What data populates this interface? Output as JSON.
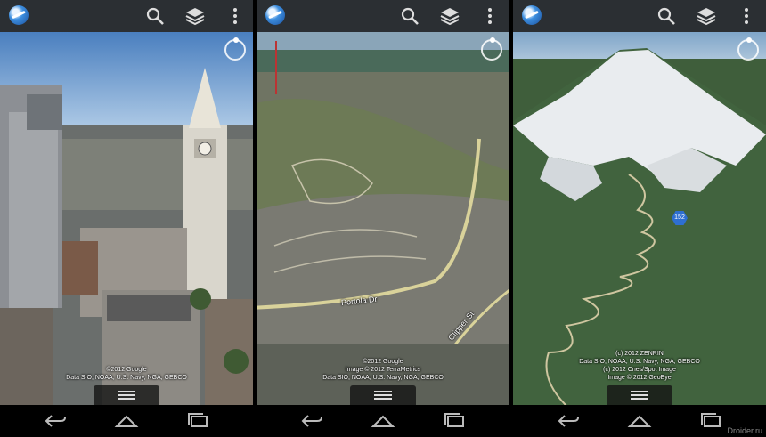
{
  "screens": [
    {
      "id": "boston",
      "attribution": [
        "",
        ""
      ],
      "attribution_lines": [
        "©2012 Google",
        "Data SIO, NOAA, U.S. Navy, NGA, GEBCO"
      ],
      "labels": []
    },
    {
      "id": "sf",
      "attribution_lines": [
        "©2012 Google",
        "Image © 2012 TerraMetrics",
        "Data SIO, NOAA, U.S. Navy, NGA, GEBCO"
      ],
      "labels": [
        "Portola Dr",
        "Clipper St"
      ]
    },
    {
      "id": "fuji",
      "attribution_lines": [
        "(c) 2012 ZENRIN",
        "Data SIO, NOAA, U.S. Navy, NGA, GEBCO",
        "(c) 2012 Cnes/Spot Image",
        "Image © 2012 GeoEye"
      ],
      "marker": "152"
    }
  ],
  "icons": {
    "logo": "google-earth-logo-icon",
    "search": "search-icon",
    "layers": "layers-icon",
    "menu": "overflow-menu-icon",
    "compass": "compass-icon",
    "back": "back-icon",
    "home": "home-icon",
    "recents": "recents-icon",
    "drawer": "drawer-handle-icon"
  },
  "watermark": "Droider.ru"
}
